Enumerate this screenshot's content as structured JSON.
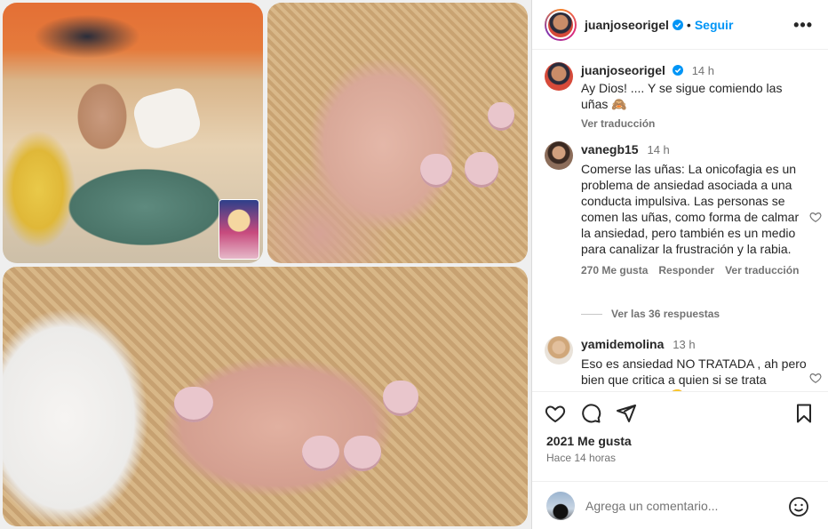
{
  "post": {
    "author": "juanjoseorigel",
    "follow_label": "Seguir",
    "more_label": "•••",
    "dot": "•"
  },
  "caption": {
    "user": "juanjoseorigel",
    "time": "14 h",
    "text": "Ay Dios! .... Y se sigue comiendo las uñas 🙈",
    "translate": "Ver traducción"
  },
  "comments": [
    {
      "user": "vanegb15",
      "time": "14 h",
      "text": "Comerse las uñas: La onicofagia es un problema de ansiedad asociada a una conducta impulsiva. Las personas se comen las uñas, como forma de calmar la ansiedad, pero también es un medio para canalizar la frustración y la rabia.",
      "likes": "270 Me gusta",
      "reply": "Responder",
      "translate": "Ver traducción",
      "replies": "Ver las 36 respuestas"
    },
    {
      "user": "yamidemolina",
      "time": "13 h",
      "text": "Eso es ansiedad NO TRATADA , ah pero bien que critica a quien si se trata médicamente... 🙄!!"
    }
  ],
  "actions": {
    "likes": "2021 Me gusta",
    "time_ago": "Hace 14 horas",
    "comment_placeholder": "Agrega un comentario..."
  },
  "colors": {
    "accent": "#0095f6",
    "verified": "#0095f6",
    "muted": "#737373"
  },
  "icons": [
    "heart-icon",
    "comment-icon",
    "share-icon",
    "bookmark-icon",
    "emoji-icon",
    "verified-icon",
    "more-icon"
  ]
}
